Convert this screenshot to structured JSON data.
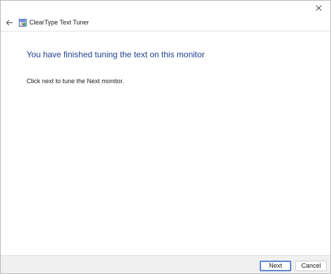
{
  "window": {
    "title": "ClearType Text Tuner"
  },
  "icons": {
    "close": "close-icon",
    "back": "back-arrow-icon",
    "app": "cleartype-app-icon"
  },
  "content": {
    "heading": "You have finished tuning the text on this monitor",
    "body": "Click next to tune the Next monitor."
  },
  "footer": {
    "next_label": "Next",
    "cancel_label": "Cancel"
  },
  "colors": {
    "heading": "#1e3f8f",
    "accent": "#2d63c5"
  }
}
